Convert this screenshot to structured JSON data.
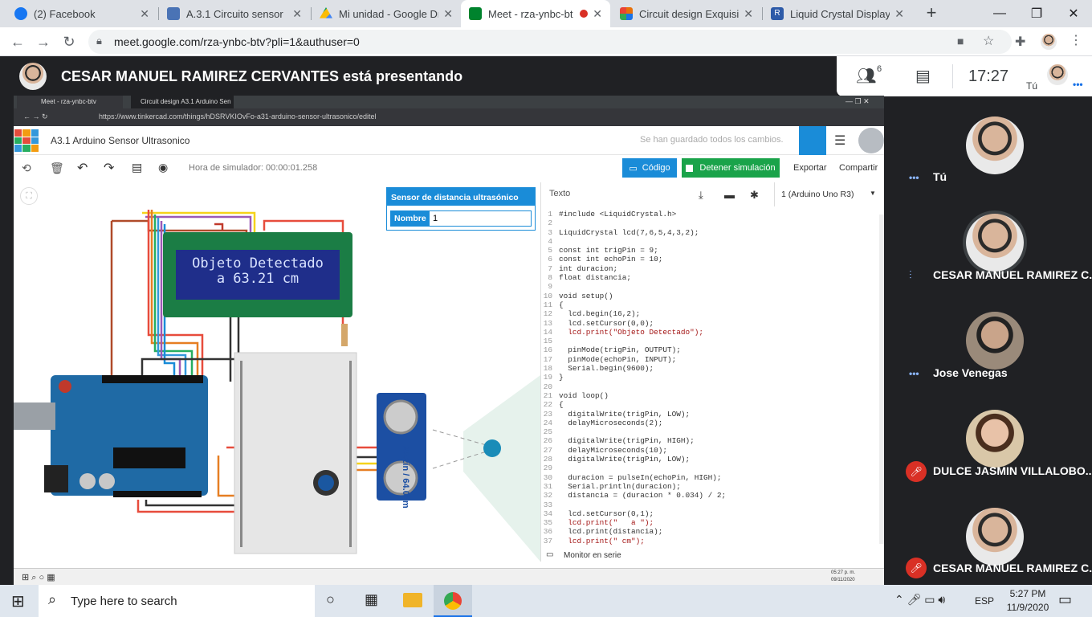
{
  "chrome": {
    "tabs": [
      {
        "title": "(2) Facebook",
        "color": "#1877f2"
      },
      {
        "title": "A.3.1 Circuito sensor",
        "color": "#4a73b5"
      },
      {
        "title": "Mi unidad - Google Dri",
        "color": "#fbbc04"
      },
      {
        "title": "Meet - rza-ynbc-bt",
        "color": "#00832d"
      },
      {
        "title": "Circuit design Exquisite",
        "color": "#e8710a"
      },
      {
        "title": "Liquid Crystal Display (I",
        "color": "#2d5aa8"
      }
    ],
    "url": "meet.google.com/rza-ynbc-btv?pli=1&authuser=0"
  },
  "meet": {
    "presenting_text": "CESAR MANUEL RAMIREZ CERVANTES está presentando",
    "participant_count": "6",
    "time": "17:27",
    "self_label": "Tú",
    "participants": [
      {
        "name": "Tú"
      },
      {
        "name": "CESAR MANUEL RAMIREZ C..."
      },
      {
        "name": "Jose Venegas"
      },
      {
        "name": "DULCE JASMIN VILLALOBO..."
      },
      {
        "name": "CESAR MANUEL RAMIREZ C..."
      }
    ]
  },
  "shared": {
    "inner_tabs": [
      "Meet - rza-ynbc-btv",
      "Circuit design A3.1 Arduino Sen"
    ],
    "inner_url": "https://www.tinkercad.com/things/hDSRVKIOvFo-a31-arduino-sensor-ultrasonico/editel",
    "project_title": "A3.1 Arduino Sensor Ultrasonico",
    "save_status": "Se han guardado todos los cambios.",
    "sim_time": "Hora de simulador: 00:00:01.258",
    "code_btn": "Código",
    "stop_btn": "Detener simulación",
    "export_btn": "Exportar",
    "share_btn": "Compartir",
    "texto_label": "Texto",
    "board_select": "1 (Arduino Uno R3)",
    "inspector_title": "Sensor de distancia ultrasónico",
    "inspector_name_label": "Nombre",
    "inspector_name_value": "1",
    "lcd_line1": "Objeto Detectado",
    "lcd_line2": "a 63.21 cm",
    "sensor_reading": "25.2in / 64.0cm",
    "serial_monitor": "Monitor en serie",
    "inner_clock": "05:27 p. m.",
    "inner_date": "09/11/2020",
    "code_lines": [
      "#include <LiquidCrystal.h>",
      "",
      "LiquidCrystal lcd(7,6,5,4,3,2);",
      "",
      "const int trigPin = 9;",
      "const int echoPin = 10;",
      "int duracion;",
      "float distancia;",
      "",
      "void setup()",
      "{",
      "  lcd.begin(16,2);",
      "  lcd.setCursor(0,0);",
      "  lcd.print(\"Objeto Detectado\");",
      "",
      "  pinMode(trigPin, OUTPUT);",
      "  pinMode(echoPin, INPUT);",
      "  Serial.begin(9600);",
      "}",
      "",
      "void loop()",
      "{",
      "  digitalWrite(trigPin, LOW);",
      "  delayMicroseconds(2);",
      "",
      "  digitalWrite(trigPin, HIGH);",
      "  delayMicroseconds(10);",
      "  digitalWrite(trigPin, LOW);",
      "",
      "  duracion = pulseIn(echoPin, HIGH);",
      "  Serial.println(duracion);",
      "  distancia = (duracion * 0.034) / 2;",
      "",
      "  lcd.setCursor(0,1);",
      "  lcd.print(\"   a \");",
      "  lcd.print(distancia);",
      "  lcd.print(\" cm\");"
    ]
  },
  "taskbar": {
    "search_placeholder": "Type here to search",
    "lang": "ESP",
    "time": "5:27 PM",
    "date": "11/9/2020"
  }
}
